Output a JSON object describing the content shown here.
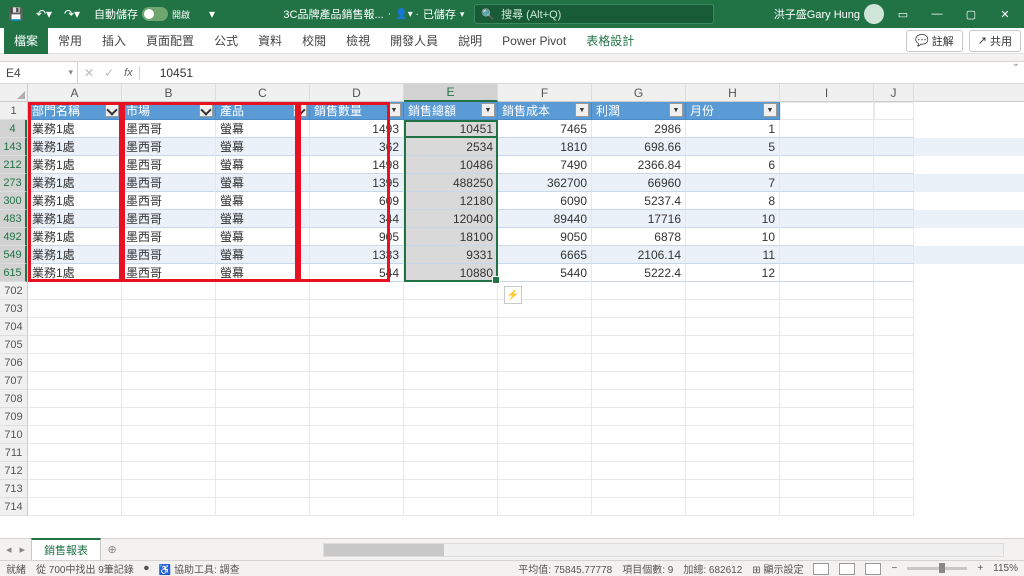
{
  "titlebar": {
    "autosave": "自動儲存",
    "autosave_state": "開啟",
    "filename": "3C品牌產品銷售報...",
    "saved": "已儲存",
    "search_placeholder": "搜尋 (Alt+Q)",
    "user": "洪子盛Gary Hung"
  },
  "ribbon": {
    "tabs": [
      "檔案",
      "常用",
      "插入",
      "頁面配置",
      "公式",
      "資料",
      "校閱",
      "檢視",
      "開發人員",
      "說明",
      "Power Pivot"
    ],
    "context_tab": "表格設計",
    "comment": "註解",
    "share": "共用"
  },
  "namebox": {
    "ref": "E4",
    "formula": "10451"
  },
  "columns": [
    "A",
    "B",
    "C",
    "D",
    "E",
    "F",
    "G",
    "H",
    "I",
    "J"
  ],
  "headers": [
    "部門名稱",
    "市場",
    "產品",
    "銷售數量",
    "銷售總額",
    "銷售成本",
    "利潤",
    "月份"
  ],
  "row_ids": [
    4,
    143,
    212,
    273,
    300,
    483,
    492,
    549,
    615
  ],
  "empty_rows": [
    702,
    703,
    704,
    705,
    706,
    707,
    708,
    709,
    710,
    711,
    712,
    713,
    714
  ],
  "data": [
    {
      "dept": "業務1處",
      "market": "墨西哥",
      "product": "螢幕",
      "qty": 1493,
      "total": 10451,
      "cost": 7465,
      "profit": 2986,
      "month": 1
    },
    {
      "dept": "業務1處",
      "market": "墨西哥",
      "product": "螢幕",
      "qty": 362,
      "total": 2534,
      "cost": 1810,
      "profit": 698.66,
      "month": 5
    },
    {
      "dept": "業務1處",
      "market": "墨西哥",
      "product": "螢幕",
      "qty": 1498,
      "total": 10486,
      "cost": 7490,
      "profit": 2366.84,
      "month": 6
    },
    {
      "dept": "業務1處",
      "market": "墨西哥",
      "product": "螢幕",
      "qty": 1395,
      "total": 488250,
      "cost": 362700,
      "profit": 66960,
      "month": 7
    },
    {
      "dept": "業務1處",
      "market": "墨西哥",
      "product": "螢幕",
      "qty": 609,
      "total": 12180,
      "cost": 6090,
      "profit": 5237.4,
      "month": 8
    },
    {
      "dept": "業務1處",
      "market": "墨西哥",
      "product": "螢幕",
      "qty": 344,
      "total": 120400,
      "cost": 89440,
      "profit": 17716,
      "month": 10
    },
    {
      "dept": "業務1處",
      "market": "墨西哥",
      "product": "螢幕",
      "qty": 905,
      "total": 18100,
      "cost": 9050,
      "profit": 6878,
      "month": 10
    },
    {
      "dept": "業務1處",
      "market": "墨西哥",
      "product": "螢幕",
      "qty": 1333,
      "total": 9331,
      "cost": 6665,
      "profit": 2106.14,
      "month": 11
    },
    {
      "dept": "業務1處",
      "market": "墨西哥",
      "product": "螢幕",
      "qty": 544,
      "total": 10880,
      "cost": 5440,
      "profit": 5222.4,
      "month": 12
    }
  ],
  "sheet": {
    "name": "銷售報表"
  },
  "status": {
    "ready": "就緒",
    "filter": "從 700中找出 9筆記錄",
    "access": "協助工具: 調查",
    "avg_label": "平均值:",
    "avg": "75845.77778",
    "count_label": "項目個數:",
    "count": "9",
    "sum_label": "加總:",
    "sum": "682612",
    "display": "顯示設定",
    "zoom": "115%"
  }
}
